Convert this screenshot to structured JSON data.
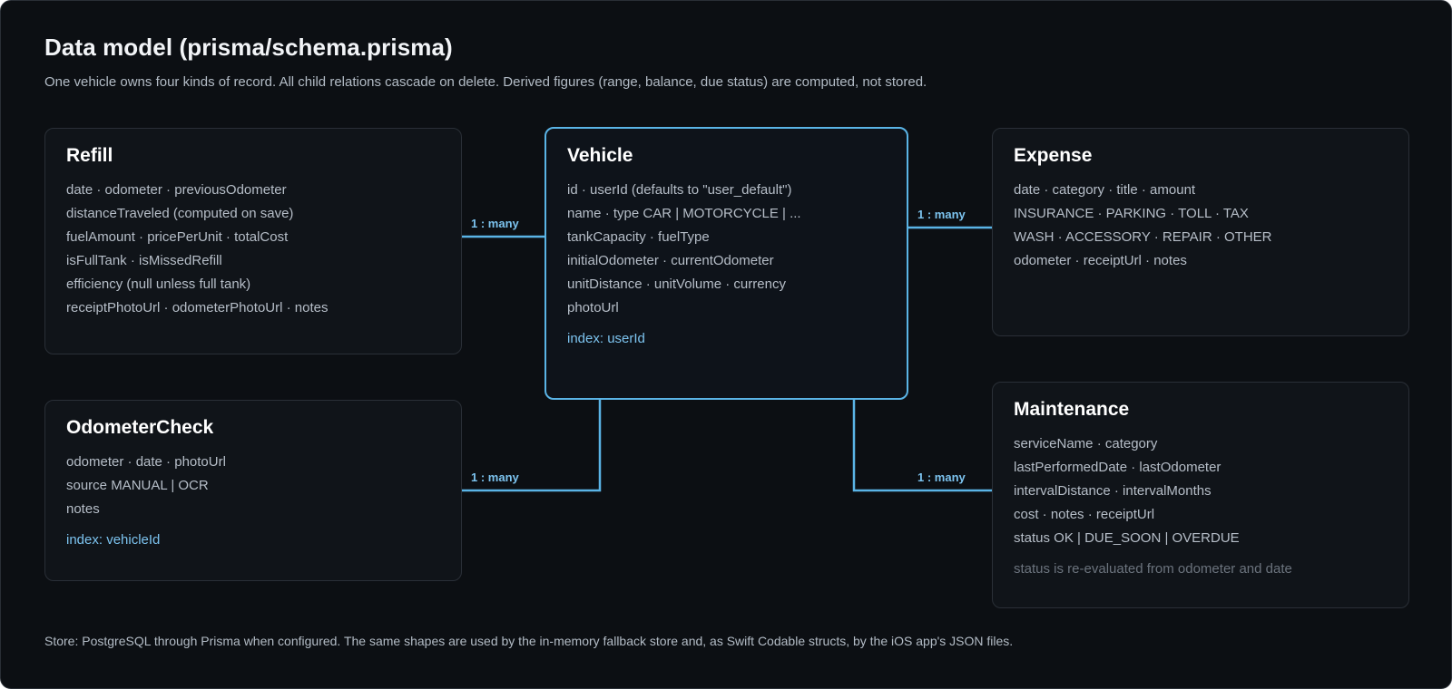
{
  "header": {
    "title": "Data model (prisma/schema.prisma)",
    "subtitle": "One vehicle owns four kinds of record. All child relations cascade on delete. Derived figures (range, balance, due status) are computed, not stored."
  },
  "entities": {
    "refill": {
      "name": "Refill",
      "fields": [
        "date · odometer · previousOdometer",
        "distanceTraveled (computed on save)",
        "fuelAmount · pricePerUnit · totalCost",
        "isFullTank · isMissedRefill",
        "efficiency (null unless full tank)",
        "receiptPhotoUrl · odometerPhotoUrl · notes"
      ]
    },
    "vehicle": {
      "name": "Vehicle",
      "fields": [
        "id · userId (defaults to \"user_default\")",
        "name · type CAR | MOTORCYCLE | ...",
        "tankCapacity · fuelType",
        "initialOdometer · currentOdometer",
        "unitDistance · unitVolume · currency",
        "photoUrl"
      ],
      "index": "index: userId"
    },
    "expense": {
      "name": "Expense",
      "fields": [
        "date · category · title · amount",
        "INSURANCE · PARKING · TOLL · TAX",
        "WASH · ACCESSORY · REPAIR · OTHER",
        "odometer · receiptUrl · notes"
      ]
    },
    "odometer_check": {
      "name": "OdometerCheck",
      "fields": [
        "odometer · date · photoUrl",
        "source MANUAL | OCR",
        "notes"
      ],
      "index": "index: vehicleId"
    },
    "maintenance": {
      "name": "Maintenance",
      "fields": [
        "serviceName · category",
        "lastPerformedDate · lastOdometer",
        "intervalDistance · intervalMonths",
        "cost · notes · receiptUrl",
        "status OK | DUE_SOON | OVERDUE"
      ],
      "note": "status is re-evaluated from odometer and date"
    }
  },
  "relations": {
    "refill": "1 : many",
    "expense": "1 : many",
    "odometer_check": "1 : many",
    "maintenance": "1 : many"
  },
  "colors": {
    "background": "#0c0f13",
    "card": "#101419",
    "accent": "#5ab4e6"
  },
  "footer": "Store: PostgreSQL through Prisma when configured. The same shapes are used by the in-memory fallback store and, as Swift Codable structs, by the iOS app's JSON files."
}
